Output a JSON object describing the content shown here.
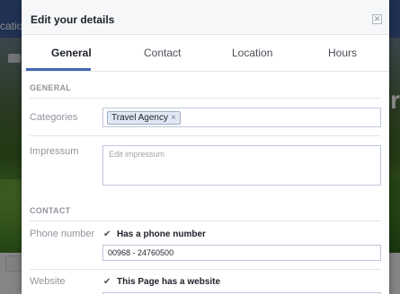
{
  "background": {
    "left_text": "cation",
    "right_letter": "r"
  },
  "modal": {
    "title": "Edit your details",
    "close_icon": "close-icon",
    "tabs": [
      {
        "label": "General",
        "active": true
      },
      {
        "label": "Contact",
        "active": false
      },
      {
        "label": "Location",
        "active": false
      },
      {
        "label": "Hours",
        "active": false
      }
    ],
    "general": {
      "header": "GENERAL",
      "categories_label": "Categories",
      "category_token": "Travel Agency",
      "impressum_label": "Impressum",
      "impressum_placeholder": "Edit impressum"
    },
    "contact": {
      "header": "CONTACT",
      "phone_label": "Phone number",
      "phone_checkbox_label": "Has a phone number",
      "phone_value": "00968 - 24760500",
      "website_label": "Website",
      "website_checkbox_label": "This Page has a website"
    },
    "accent_color": "#4267b2"
  }
}
